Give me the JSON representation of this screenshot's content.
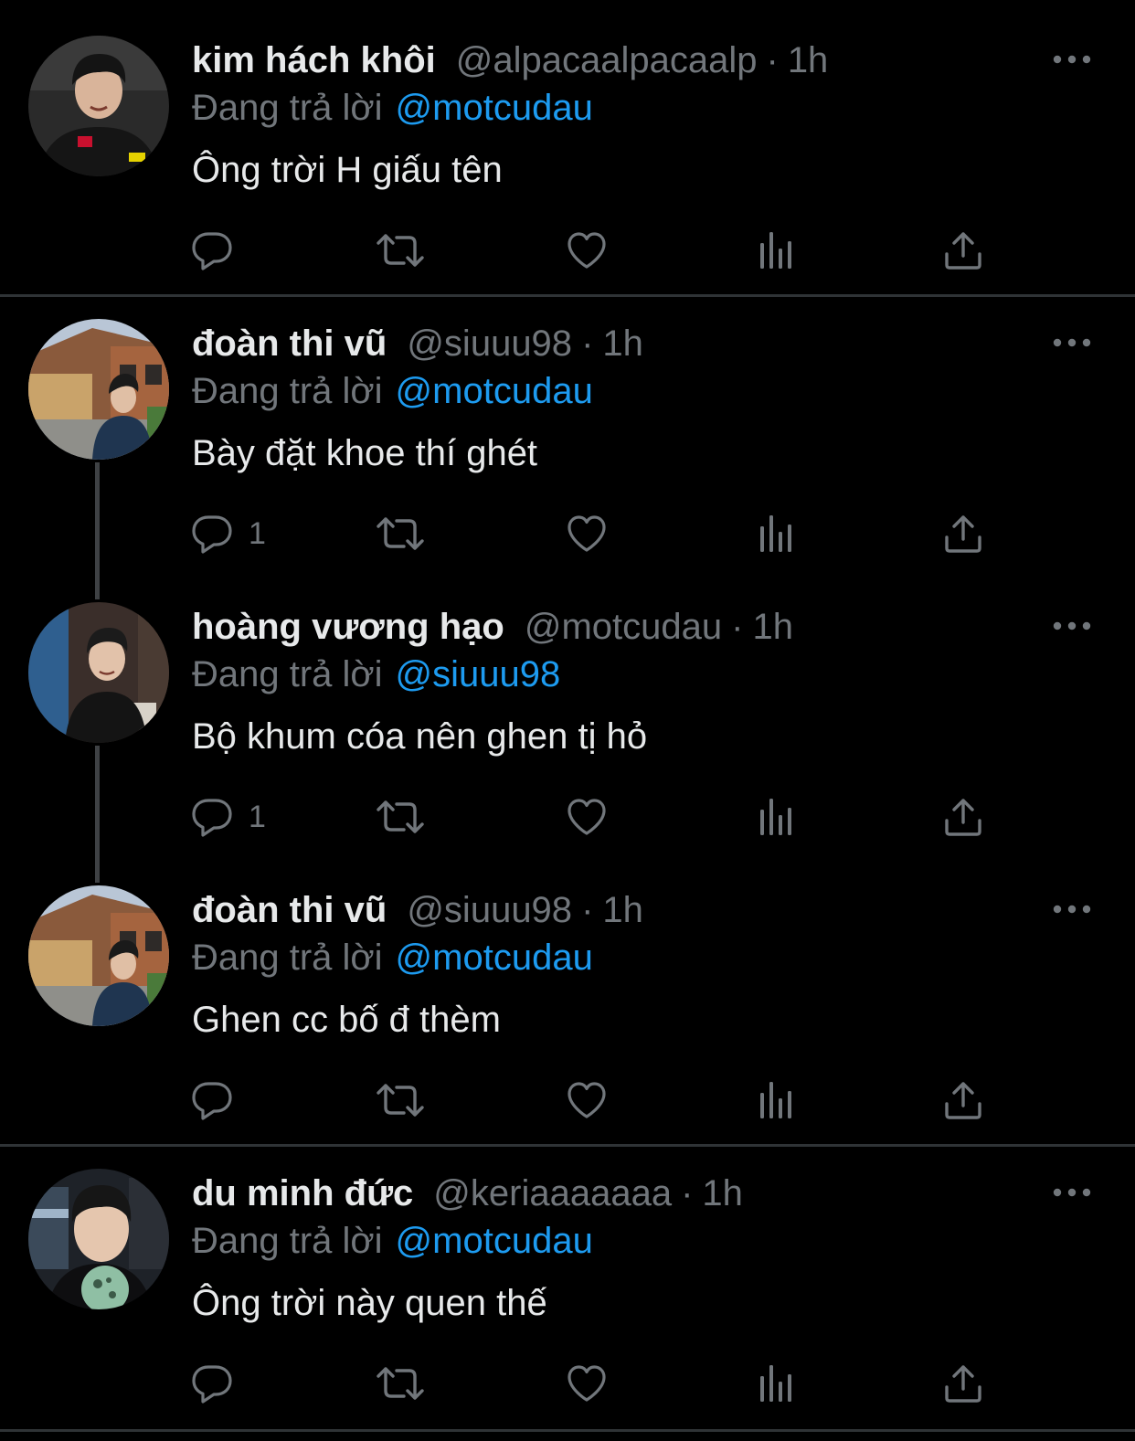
{
  "colors": {
    "background": "#000000",
    "text": "#e7e9ea",
    "secondary": "#71767b",
    "accent": "#1d9bf0",
    "divider": "#2f3336",
    "thread_line": "#3e4144"
  },
  "icons": {
    "reply": "reply-icon",
    "retweet": "retweet-icon",
    "like": "like-icon",
    "views": "views-icon",
    "share": "share-icon",
    "more": "more-icon"
  },
  "tweets": [
    {
      "name": "kim hách khôi",
      "handle": "@alpacaalpacaalp",
      "dot": "·",
      "time": "1h",
      "reply_prefix": "Đang trả lời",
      "reply_to": "@motcudau",
      "text": "Ông trời H giấu tên",
      "reply_count": ""
    },
    {
      "name": "đoàn thi vũ",
      "handle": "@siuuu98",
      "dot": "·",
      "time": "1h",
      "reply_prefix": "Đang trả lời",
      "reply_to": "@motcudau",
      "text": "Bày đặt khoe thí ghét",
      "reply_count": "1"
    },
    {
      "name": "hoàng vương hạo",
      "handle": "@motcudau",
      "dot": "·",
      "time": "1h",
      "reply_prefix": "Đang trả lời",
      "reply_to": "@siuuu98",
      "text": "Bộ khum cóa nên ghen tị hỏ",
      "reply_count": "1"
    },
    {
      "name": "đoàn thi vũ",
      "handle": "@siuuu98",
      "dot": "·",
      "time": "1h",
      "reply_prefix": "Đang trả lời",
      "reply_to": "@motcudau",
      "text": "Ghen cc bố đ thèm",
      "reply_count": ""
    },
    {
      "name": "du minh đức",
      "handle": "@keriaaaaaaa",
      "dot": "·",
      "time": "1h",
      "reply_prefix": "Đang trả lời",
      "reply_to": "@motcudau",
      "text": "Ông trời này quen thế",
      "reply_count": ""
    }
  ]
}
